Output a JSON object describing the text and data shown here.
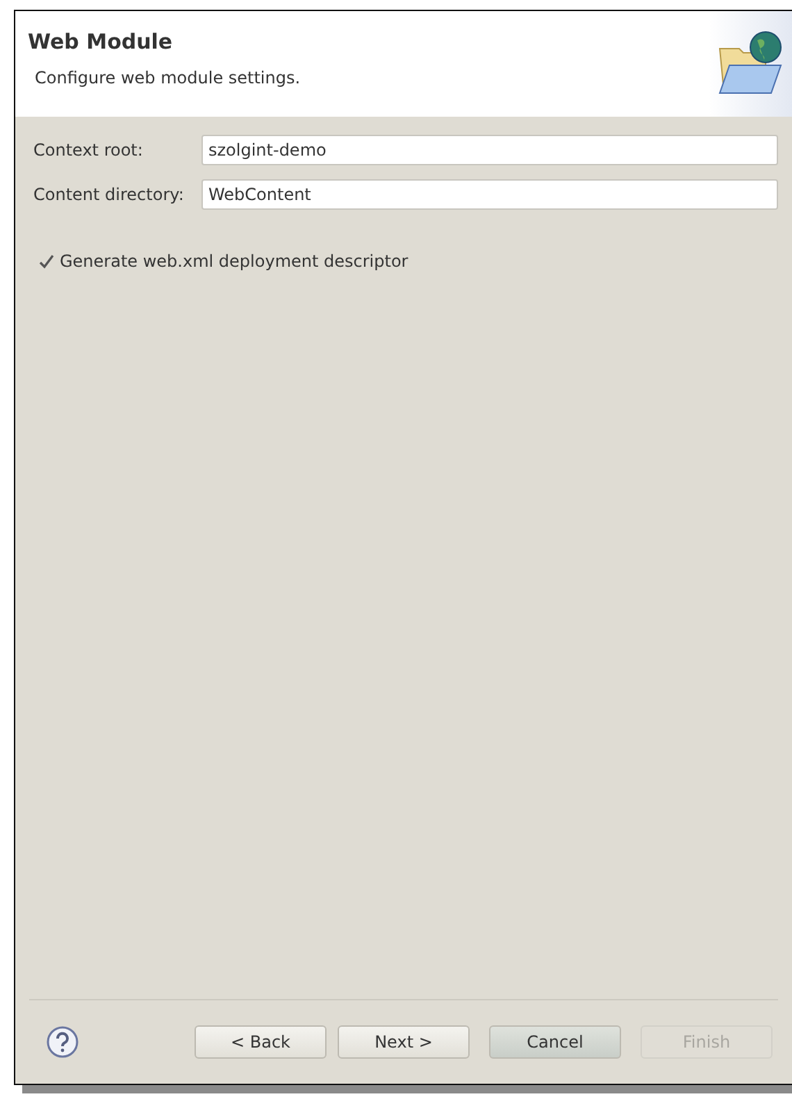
{
  "header": {
    "title": "Web Module",
    "description": "Configure web module settings."
  },
  "fields": [
    {
      "label": "Context root:",
      "value": "szolgint-demo"
    },
    {
      "label": "Content directory:",
      "value": "WebContent"
    }
  ],
  "checkbox": {
    "label": "Generate web.xml deployment descriptor",
    "checked": true
  },
  "buttons": [
    {
      "label": "< Back",
      "disabled": false,
      "focused": false
    },
    {
      "label": "Next >",
      "disabled": false,
      "focused": false
    },
    {
      "label": "Cancel",
      "disabled": false,
      "focused": true
    },
    {
      "label": "Finish",
      "disabled": true,
      "focused": false
    }
  ]
}
